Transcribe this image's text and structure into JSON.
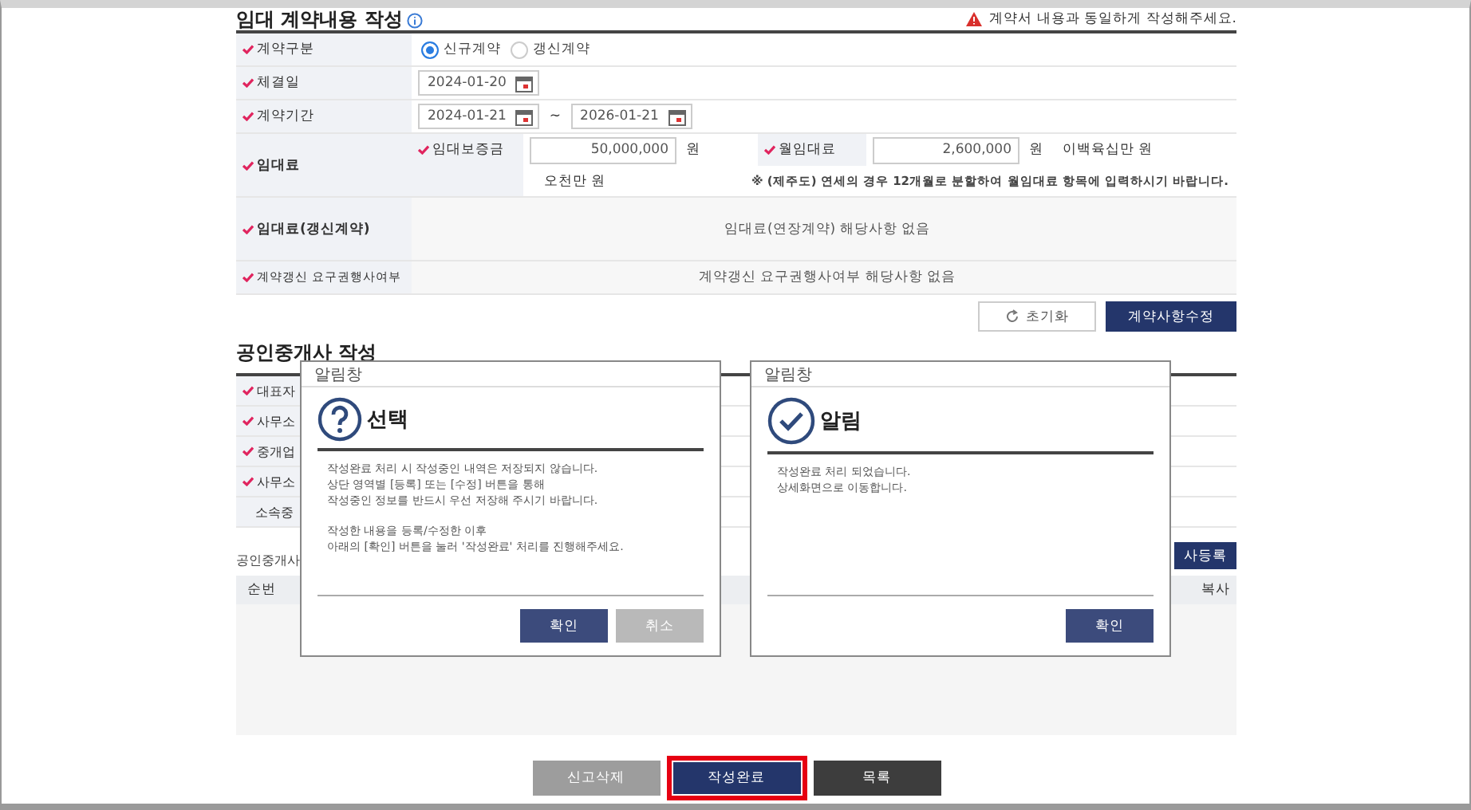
{
  "contract": {
    "title": "임대 계약내용 작성",
    "warning": "계약서 내용과 동일하게 작성해주세요.",
    "contract_type": {
      "label": "계약구분",
      "options": [
        {
          "label": "신규계약",
          "selected": true
        },
        {
          "label": "갱신계약",
          "selected": false
        }
      ]
    },
    "signed_date": {
      "label": "체결일",
      "value": "2024-01-20"
    },
    "period": {
      "label": "계약기간",
      "start": "2024-01-21",
      "separator": "~",
      "end": "2026-01-21"
    },
    "rent": {
      "label": "임대료",
      "deposit": {
        "label": "임대보증금",
        "value": "50,000,000",
        "unit": "원",
        "in_words": "오천만 원"
      },
      "monthly": {
        "label": "월임대료",
        "value": "2,600,000",
        "unit": "원",
        "in_words": "이백육십만 원"
      },
      "note": "※ (제주도) 연세의 경우 12개월로 분할하여 월임대료 항목에 입력하시기 바랍니다."
    },
    "renewal_rent": {
      "label": "임대료(갱신계약)",
      "value": "임대료(연장계약) 해당사항 없음"
    },
    "renewal_right": {
      "label": "계약갱신 요구권행사여부",
      "value": "계약갱신 요구권행사여부 해당사항 없음"
    },
    "actions": [
      {
        "label": "초기화",
        "kind": "reset"
      },
      {
        "label": "계약사항수정",
        "kind": "primary"
      }
    ]
  },
  "broker": {
    "title": "공인중개사 작성",
    "rows": [
      {
        "label": "대표자",
        "required": true
      },
      {
        "label": "사무소",
        "required": true
      },
      {
        "label": "중개업",
        "required": true
      },
      {
        "label": "사무소",
        "required": true
      },
      {
        "label": "소속중",
        "required": false
      }
    ],
    "side_button": "사등록",
    "list_label": "공인중개사",
    "columns": [
      "순번",
      "복사"
    ]
  },
  "dialogs": [
    {
      "window_title": "알림창",
      "kind": "question",
      "heading": "선택",
      "paragraphs": [
        [
          "작성완료 처리 시 작성중인 내역은 저장되지 않습니다.",
          "상단 영역별 [등록] 또는 [수정] 버튼을 통해",
          "작성중인 정보를 반드시 우선 저장해 주시기 바랍니다."
        ],
        [
          "작성한 내용을 등록/수정한 이후",
          "아래의 [확인] 버튼을 눌러 '작성완료' 처리를 진행해주세요."
        ]
      ],
      "buttons": [
        {
          "label": "확인",
          "kind": "primary"
        },
        {
          "label": "취소",
          "kind": "secondary"
        }
      ]
    },
    {
      "window_title": "알림창",
      "kind": "check",
      "heading": "알림",
      "paragraphs": [
        [
          "작성완료 처리 되었습니다.",
          "상세화면으로 이동합니다."
        ]
      ],
      "buttons": [
        {
          "label": "확인",
          "kind": "primary"
        }
      ]
    }
  ],
  "footer_buttons": [
    {
      "label": "신고삭제",
      "kind": "gray",
      "highlighted": false
    },
    {
      "label": "작성완료",
      "kind": "primary",
      "highlighted": true
    },
    {
      "label": "목록",
      "kind": "dark",
      "highlighted": false
    }
  ]
}
